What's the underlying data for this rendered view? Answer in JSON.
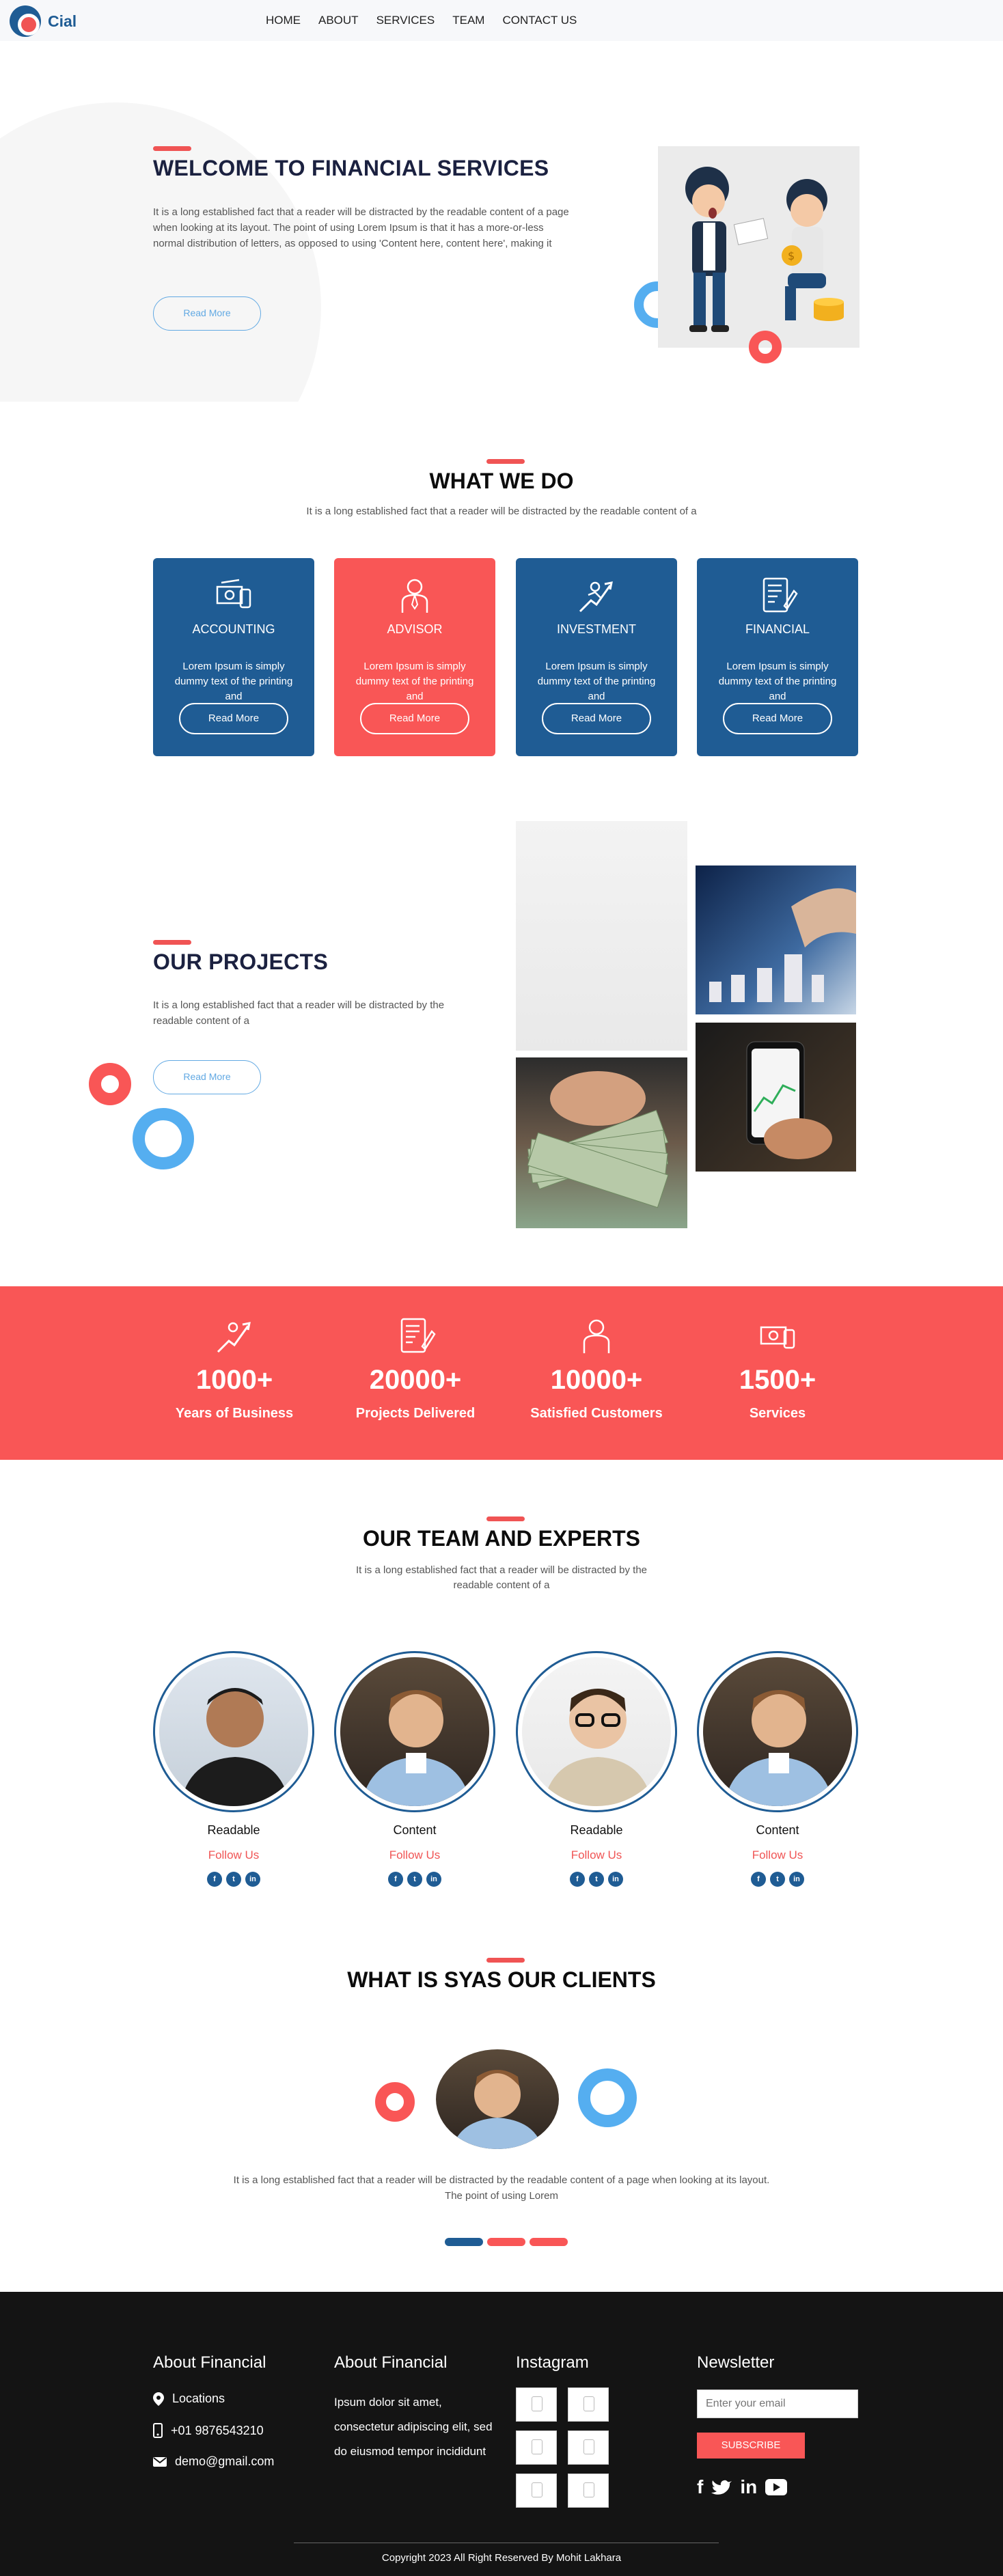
{
  "header": {
    "brand": "Cial",
    "nav": [
      "HOME",
      "ABOUT",
      "SERVICES",
      "TEAM",
      "CONTACT US"
    ]
  },
  "hero": {
    "title": "WELCOME TO FINANCIAL SERVICES",
    "text": "It is a long established fact that a reader will be distracted by the readable content of a page when looking at its layout. The point of using Lorem Ipsum is that it has a more-or-less normal distribution of letters, as opposed to using 'Content here, content here', making it",
    "button": "Read More"
  },
  "services": {
    "title": "WHAT WE DO",
    "subtitle": "It is a long established fact that a reader will be distracted by the readable content of a",
    "cards": [
      {
        "title": "ACCOUNTING",
        "text": "Lorem Ipsum is simply dummy text of the printing and",
        "button": "Read More",
        "icon": "cash-icon"
      },
      {
        "title": "ADVISOR",
        "text": "Lorem Ipsum is simply dummy text of the printing and",
        "button": "Read More",
        "icon": "advisor-icon"
      },
      {
        "title": "INVESTMENT",
        "text": "Lorem Ipsum is simply dummy text of the printing and",
        "button": "Read More",
        "icon": "growth-icon"
      },
      {
        "title": "FINANCIAL",
        "text": "Lorem Ipsum is simply dummy text of the printing and",
        "button": "Read More",
        "icon": "document-icon"
      }
    ]
  },
  "projects": {
    "title": "OUR PROJECTS",
    "text": "It is a long established fact that a reader will be distracted by the readable content of a",
    "button": "Read More"
  },
  "stats": [
    {
      "number": "1000+",
      "label": "Years of Business",
      "icon": "growth-icon"
    },
    {
      "number": "20000+",
      "label": "Projects Delivered",
      "icon": "document-icon"
    },
    {
      "number": "10000+",
      "label": "Satisfied Customers",
      "icon": "advisor-icon"
    },
    {
      "number": "1500+",
      "label": "Services",
      "icon": "cash-icon"
    }
  ],
  "team": {
    "title": "OUR TEAM AND EXPERTS",
    "subtitle": "It is a long established fact that a reader will be distracted by the readable content of a",
    "members": [
      {
        "name": "Readable",
        "follow": "Follow Us"
      },
      {
        "name": "Content",
        "follow": "Follow Us"
      },
      {
        "name": "Readable",
        "follow": "Follow Us"
      },
      {
        "name": "Content",
        "follow": "Follow Us"
      }
    ]
  },
  "testimonials": {
    "title": "WHAT IS SYAS OUR CLIENTS",
    "text": "It is a long established fact that a reader will be distracted by the readable content of a page when looking at its layout. The point of using Lorem"
  },
  "footer": {
    "col1": {
      "title": "About Financial",
      "location": "Locations",
      "phone": "+01 9876543210",
      "email": "demo@gmail.com"
    },
    "col2": {
      "title": "About Financial",
      "text": "Ipsum dolor sit amet, consectetur adipiscing elit, sed do eiusmod tempor incididunt"
    },
    "col3": {
      "title": "Instagram"
    },
    "col4": {
      "title": "Newsletter",
      "placeholder": "Enter your email",
      "button": "SUBSCRIBE"
    },
    "copyright": "Copyright 2023 All Right Reserved By Mohit Lakhara"
  },
  "colors": {
    "primary": "#1f5c94",
    "accent": "#f95656",
    "light_blue": "#55aef0"
  }
}
